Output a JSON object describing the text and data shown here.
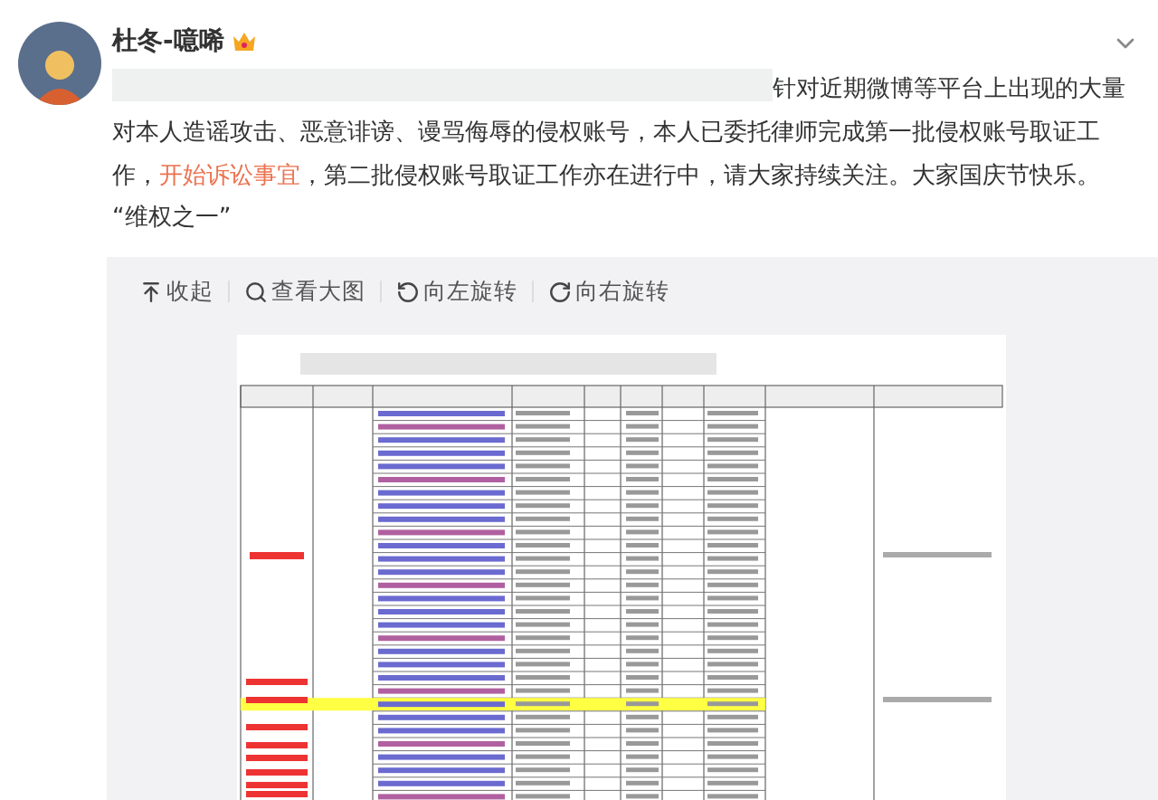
{
  "post": {
    "author": "杜冬-噫唏",
    "verified": true,
    "text_before": "针对近期微博等平台上出现的大量对本人造谣攻击、恶意诽谤、谩骂侮辱的侵权账号，本人已委托律师完成第一批侵权账号取证工作，",
    "link": "开始诉讼事宜",
    "text_after": "，第二批侵权账号取证工作亦在进行中，请大家持续关注。大家国庆节快乐。",
    "tag": "“维权之一”"
  },
  "image_toolbar": [
    {
      "kind": "collapse",
      "label": "收起"
    },
    {
      "kind": "zoom",
      "label": "查看大图"
    },
    {
      "kind": "rotate-left",
      "label": "向左旋转"
    },
    {
      "kind": "rotate-right",
      "label": "向右旋转"
    }
  ]
}
